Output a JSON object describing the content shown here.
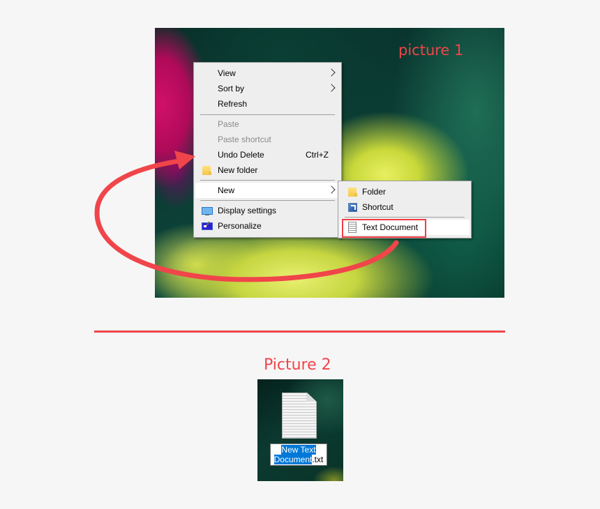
{
  "picture1": {
    "label": "picture 1",
    "context_menu": {
      "items": [
        {
          "label": "View",
          "submenu": true,
          "disabled": false
        },
        {
          "label": "Sort by",
          "submenu": true,
          "disabled": false
        },
        {
          "label": "Refresh",
          "disabled": false
        },
        {
          "label": "Paste",
          "disabled": true
        },
        {
          "label": "Paste shortcut",
          "disabled": true
        },
        {
          "label": "Undo Delete",
          "shortcut": "Ctrl+Z",
          "disabled": false
        },
        {
          "label": "New folder",
          "icon": "folder-icon",
          "disabled": false
        },
        {
          "label": "New",
          "submenu": true,
          "highlighted": true,
          "disabled": false
        },
        {
          "label": "Display settings",
          "icon": "display-icon",
          "disabled": false
        },
        {
          "label": "Personalize",
          "icon": "personalize-icon",
          "disabled": false
        }
      ]
    },
    "new_submenu": {
      "items": [
        {
          "label": "Folder",
          "icon": "folder-icon"
        },
        {
          "label": "Shortcut",
          "icon": "shortcut-icon"
        },
        {
          "label": "Text Document",
          "icon": "text-document-icon",
          "highlighted": true
        }
      ]
    }
  },
  "picture2": {
    "label": "Picture 2",
    "file_icon": "text-document-icon",
    "rename_selected": "New Text Document",
    "rename_line1": "New Text",
    "rename_line2_selected": "Document",
    "rename_extension": ".txt"
  },
  "colors": {
    "annotation_red": "#f0454a",
    "selection_blue": "#0078d7",
    "menu_background": "#eeeeee"
  }
}
